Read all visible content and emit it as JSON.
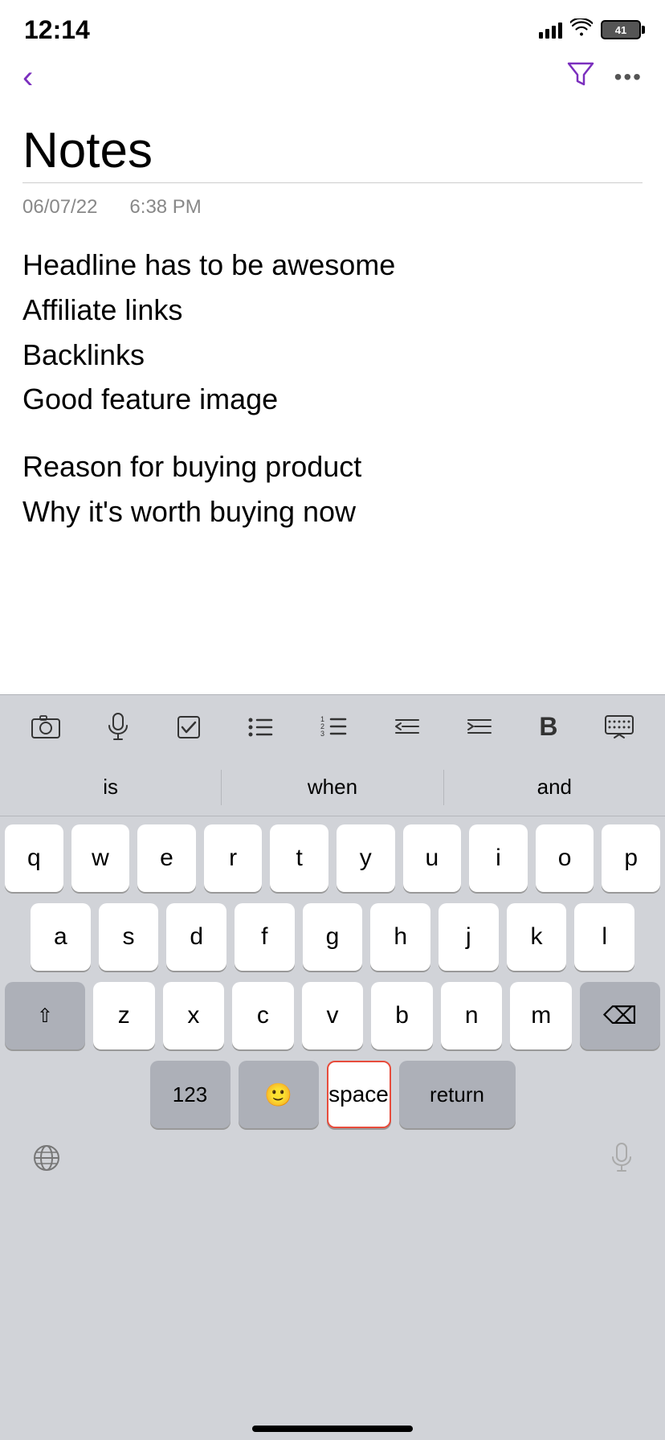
{
  "statusBar": {
    "time": "12:14",
    "battery": "41"
  },
  "nav": {
    "backLabel": "‹",
    "moreLabel": "•••"
  },
  "note": {
    "title": "Notes",
    "date": "06/07/22",
    "time": "6:38 PM",
    "lines": [
      "Headline has to be awesome",
      "Affiliate links",
      "Backlinks",
      "Good feature image",
      "",
      "Reason for buying product",
      "Why it's worth buying now"
    ]
  },
  "suggestions": {
    "left": "is",
    "center": "when",
    "right": "and"
  },
  "keyboard": {
    "row1": [
      "q",
      "w",
      "e",
      "r",
      "t",
      "y",
      "u",
      "i",
      "o",
      "p"
    ],
    "row2": [
      "a",
      "s",
      "d",
      "f",
      "g",
      "h",
      "j",
      "k",
      "l"
    ],
    "row3": [
      "z",
      "x",
      "c",
      "v",
      "b",
      "n",
      "m"
    ],
    "spaceLabel": "space",
    "returnLabel": "return",
    "numLabel": "123",
    "shift": "⇧",
    "backspace": "⌫"
  },
  "toolbar": {
    "camera": "📷",
    "mic": "🎙",
    "checkbox": "☑",
    "list": "≡",
    "numberedList": "⒈",
    "outdent": "⇤",
    "indent": "⇥",
    "bold": "B",
    "hideKeyboard": "⌨"
  }
}
